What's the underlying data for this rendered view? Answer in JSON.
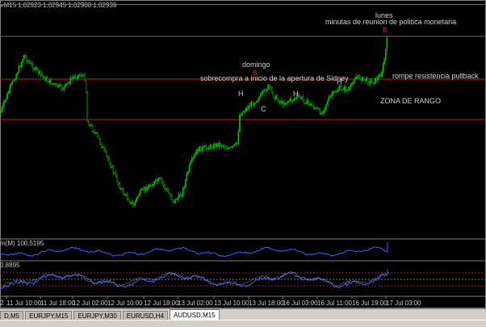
{
  "window": {
    "title_symbol": "»M15",
    "ohlc": "1.02923 1.02945 1.02900 1.02939"
  },
  "colors": {
    "background": "#000000",
    "candles": "#00c800",
    "levels": "#c81e1e",
    "oscillator": "#4060ff",
    "annotation_text": "#c8c8c8",
    "marker": "#ff2020"
  },
  "annotations": {
    "lunes": "lunes",
    "minutas": "minutas de reunion de politica monetaria",
    "domingo": "domingo",
    "sobrecompra": "sobrecompra a inicio de la apertura de Sidney",
    "rompe": "rompe resistencia pullback",
    "zona": "ZONA DE RANGO",
    "marker_b": "B",
    "h1": "H",
    "c1": "C",
    "h2": "H",
    "h3": "H"
  },
  "indicators": {
    "ind1_label": "m(M) 100.5195",
    "ind2_label": "0.8895"
  },
  "time_axis": {
    "left_stub": "2",
    "labels": [
      "11 Jul 10:00",
      "11 Jul 18:00",
      "12 Jul 02:00",
      "12 Jul 10:00",
      "12 Jul 18:00",
      "13 Jul 02:00",
      "13 Jul 10:00",
      "13 Jul 18:00",
      "16 Jul 03:00",
      "16 Jul 11:00",
      "16 Jul 19:00",
      "17 Jul 03:00"
    ]
  },
  "tabs": [
    {
      "label": "D,M5",
      "active": false
    },
    {
      "label": "EURJPY,M15",
      "active": false
    },
    {
      "label": "EURJPY,M30",
      "active": false
    },
    {
      "label": "EURUSD,H4",
      "active": false
    },
    {
      "label": "AUDUSD,M15",
      "active": true
    }
  ]
}
